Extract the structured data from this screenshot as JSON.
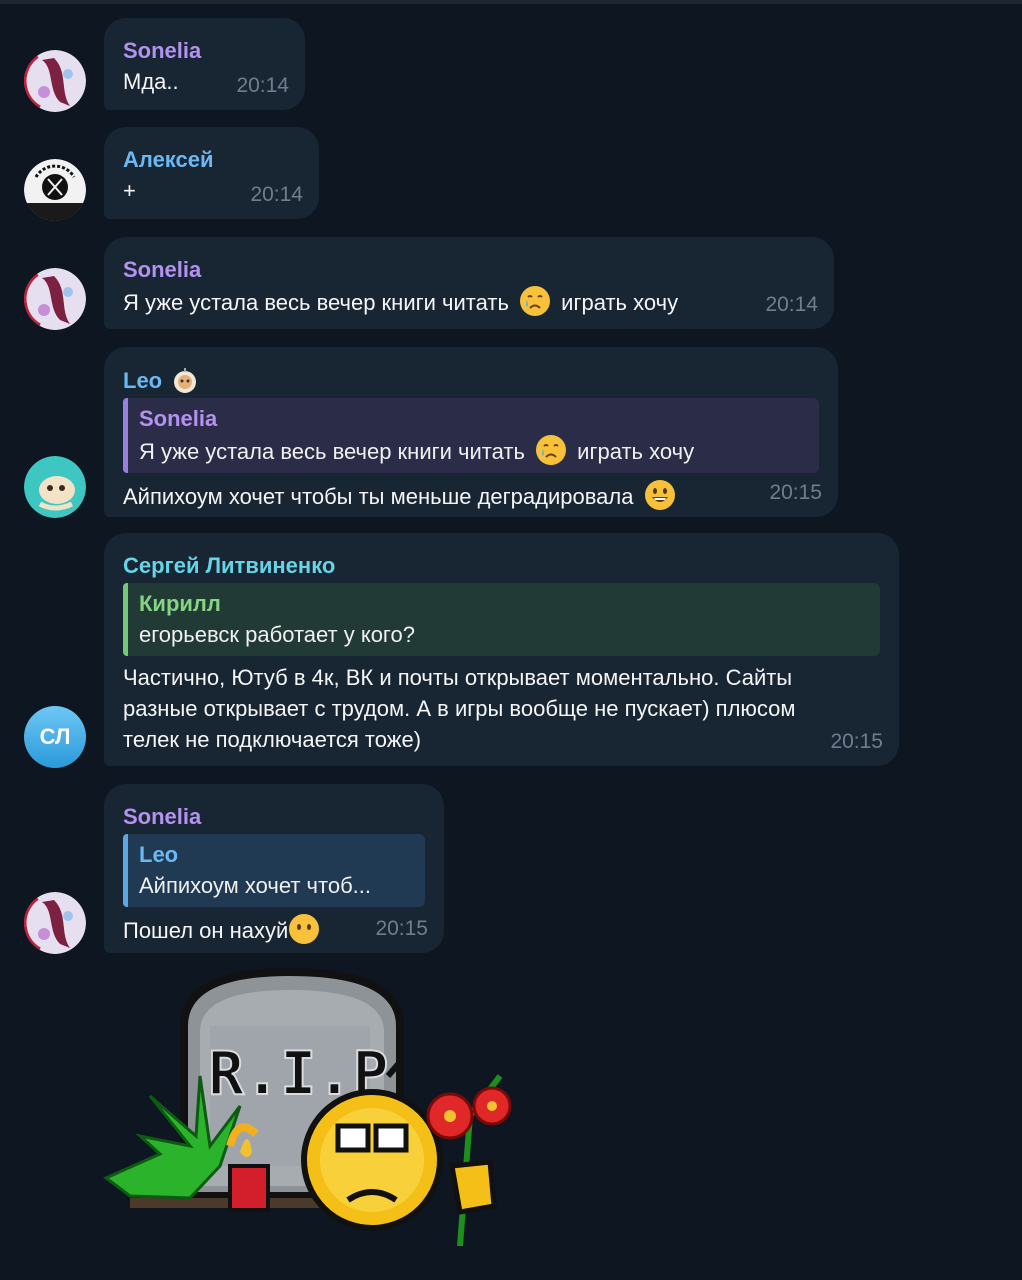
{
  "messages": [
    {
      "sender": "Sonelia",
      "text": "Мда..",
      "time": "20:14"
    },
    {
      "sender": "Алексей",
      "text": "+",
      "time": "20:14"
    },
    {
      "sender": "Sonelia",
      "text_before": "Я уже устала весь вечер книги читать",
      "text_after": "играть хочу",
      "time": "20:14"
    },
    {
      "sender": "Leo",
      "reply_name": "Sonelia",
      "reply_before": "Я уже устала весь вечер книги читать",
      "reply_after": "играть хочу",
      "text": "Айпихоум хочет чтобы ты меньше деградировала",
      "time": "20:15"
    },
    {
      "sender": "Сергей Литвиненко",
      "avatar_initials": "СЛ",
      "reply_name": "Кирилл",
      "reply_text": "егорьевск работает у кого?",
      "lines": [
        "Частично, Ютуб в 4к, ВК и почты открывает моментально. Сайты",
        "разные открывает с трудом. А в игры вообще не пускает) плюсом",
        "телек не подключается тоже)"
      ],
      "time": "20:15"
    },
    {
      "sender": "Sonelia",
      "reply_name": "Leo",
      "reply_text": "Айпихоум хочет чтоб...",
      "text": "Пошел он нахуй",
      "time": "20:15"
    }
  ],
  "sticker": {
    "text": "R.I.P",
    "icon": "rip-tombstone-sticker"
  },
  "colors": {
    "background": "#0e1621",
    "bubble": "#182533",
    "sonelia": "#b392f0",
    "aleksey": "#6cb8f3",
    "leo": "#6cb8f3",
    "sergey": "#66d3e6",
    "kirill": "#85d484",
    "time": "#6d7f8f"
  }
}
